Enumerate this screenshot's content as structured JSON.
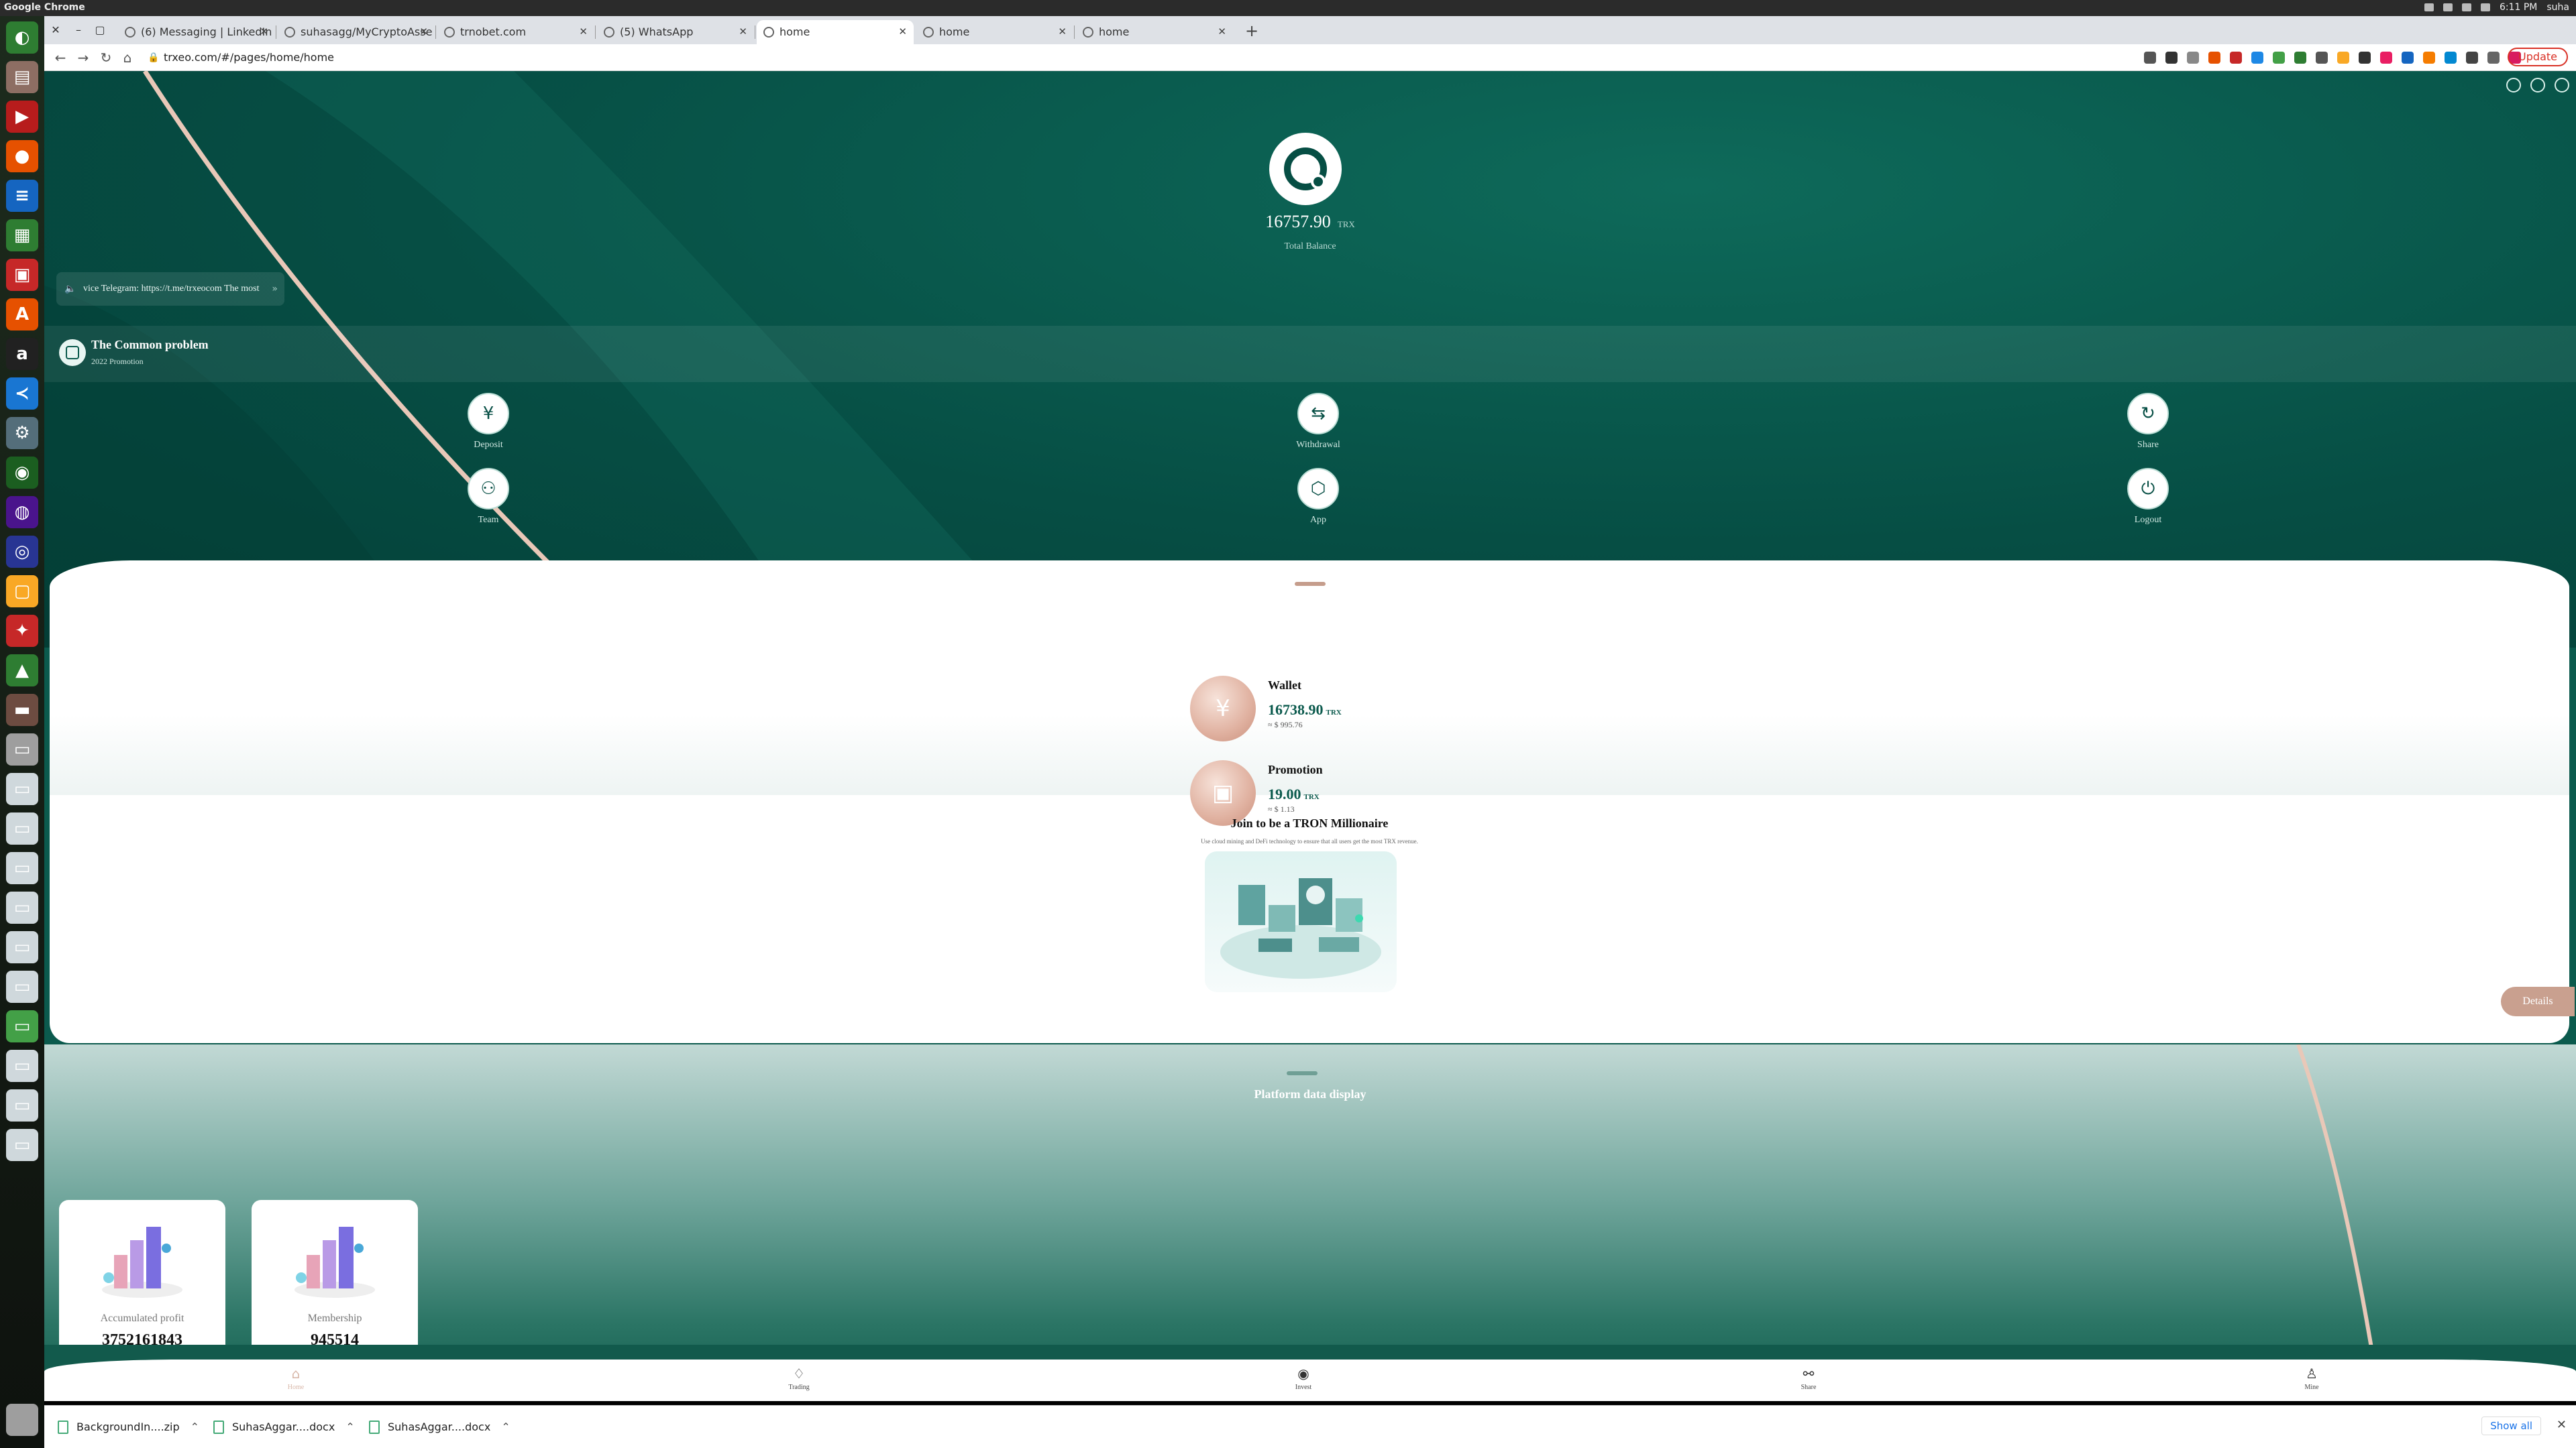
{
  "os": {
    "app_name": "Google Chrome",
    "time": "6:11 PM",
    "user": "suha"
  },
  "browser": {
    "tabs": [
      {
        "title": "(6) Messaging | LinkedIn",
        "active": false
      },
      {
        "title": "suhasagg/MyCryptoAsse",
        "active": false
      },
      {
        "title": "trnobet.com",
        "active": false
      },
      {
        "title": "(5) WhatsApp",
        "active": false
      },
      {
        "title": "home",
        "active": true
      },
      {
        "title": "home",
        "active": false
      },
      {
        "title": "home",
        "active": false
      }
    ],
    "url": "trxeo.com/#/pages/home/home",
    "update_label": "Update"
  },
  "page": {
    "balance_amount": "16757.90",
    "balance_unit": "TRX",
    "balance_label": "Total Balance",
    "notice_text": "vice Telegram: https://t.me/trxeocom The most",
    "promo_title": "The Common problem",
    "promo_sub": "2022 Promotion",
    "actions": [
      {
        "label": "Deposit",
        "icon": "deposit-icon",
        "glyph": "¥"
      },
      {
        "label": "Withdrawal",
        "icon": "withdrawal-icon",
        "glyph": "⇆"
      },
      {
        "label": "Share",
        "icon": "share-icon",
        "glyph": "↻"
      },
      {
        "label": "Team",
        "icon": "team-icon",
        "glyph": "⚇"
      },
      {
        "label": "App",
        "icon": "app-icon",
        "glyph": "⬡"
      },
      {
        "label": "Logout",
        "icon": "logout-icon",
        "glyph": "⏻"
      }
    ],
    "wallet": {
      "name": "Wallet",
      "value": "16738.90",
      "unit": "TRX",
      "usd": "≈ $ 995.76"
    },
    "promotion": {
      "name": "Promotion",
      "value": "19.00",
      "unit": "TRX",
      "usd": "≈ $ 1.13"
    },
    "join_title": "Join to be a TRON Millionaire",
    "join_sub": "Use cloud mining and DeFi technology to ensure that all users get the most TRX revenue.",
    "details_label": "Details",
    "platform_title": "Platform data display",
    "stats": [
      {
        "label": "Accumulated profit",
        "value": "3752161843"
      },
      {
        "label": "Membership",
        "value": "945514"
      }
    ]
  },
  "bottom_nav": [
    {
      "label": "Home",
      "icon": "home-icon",
      "active": true
    },
    {
      "label": "Trading",
      "icon": "trading-icon",
      "active": false
    },
    {
      "label": "Invest",
      "icon": "invest-icon",
      "active": false
    },
    {
      "label": "Share",
      "icon": "share-nav-icon",
      "active": false
    },
    {
      "label": "Mine",
      "icon": "mine-icon",
      "active": false
    }
  ],
  "downloads": [
    {
      "name": "BackgroundIn....zip"
    },
    {
      "name": "SuhasAggar....docx"
    },
    {
      "name": "SuhasAggar....docx"
    }
  ],
  "show_all_label": "Show all",
  "colors": {
    "primary": "#0b5a4d",
    "accent": "#c9a08f",
    "update_red": "#d93025"
  }
}
